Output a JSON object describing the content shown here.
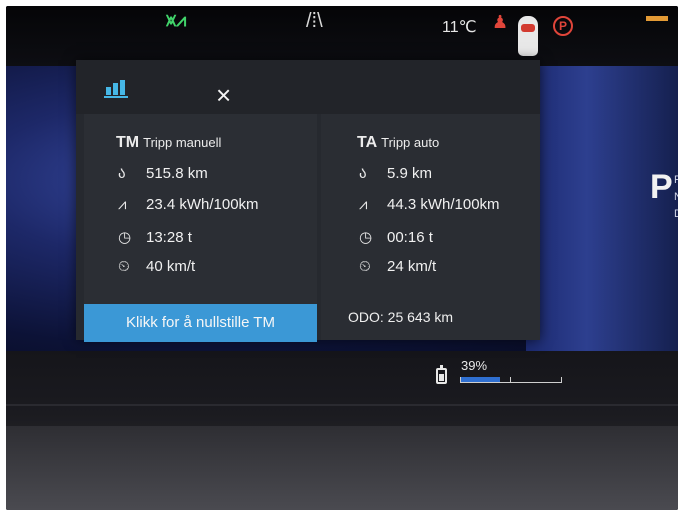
{
  "status_bar": {
    "headlight_icon": "headlight-icon",
    "road_icon": "lane-road-icon",
    "temperature": "11℃",
    "seatbelt_icon": "seatbelt-warning-icon",
    "parking_brake_icon": "P",
    "colors": {
      "headlight": "#41d36a",
      "warning": "#e0453a",
      "fuel": "#e39a35"
    }
  },
  "gear": {
    "selected": "P",
    "others": "R N D"
  },
  "trip_popup": {
    "stats_icon": "bar-chart-icon",
    "close_icon": "×",
    "manual": {
      "code": "TM",
      "name": "Tripp manuell",
      "distance": "515.8 km",
      "consumption": "23.4 kWh/100km",
      "time": "13:28 t",
      "avg_speed": "40 km/t"
    },
    "auto": {
      "code": "TA",
      "name": "Tripp auto",
      "distance": "5.9 km",
      "consumption": "44.3 kWh/100km",
      "time": "00:16 t",
      "avg_speed": "24 km/t"
    },
    "reset_button": "Klikk for å nullstille TM",
    "odometer": "ODO: 25 643 km",
    "accent_color": "#3b98d6"
  },
  "battery": {
    "percent_label": "39%",
    "level": 0.39
  }
}
